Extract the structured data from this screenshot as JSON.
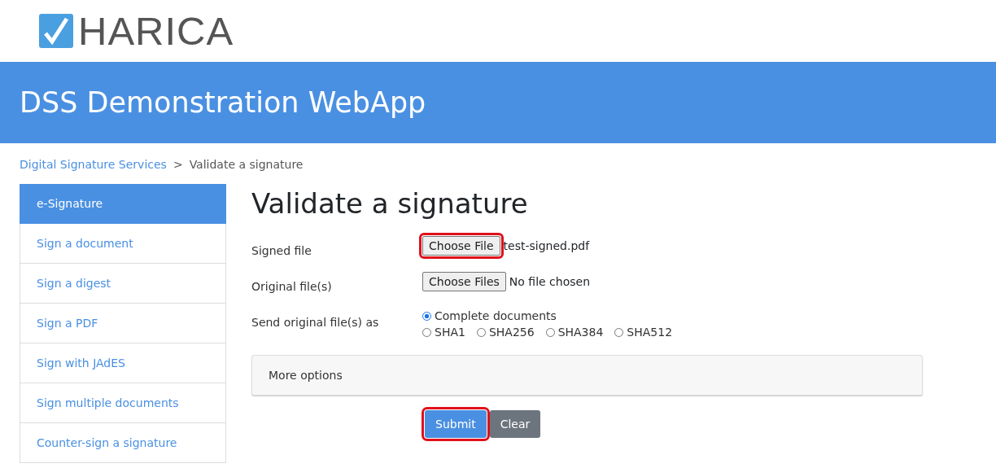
{
  "logo": {
    "text": "HARICA"
  },
  "header": {
    "title": "DSS Demonstration WebApp"
  },
  "breadcrumb": [
    {
      "label": "Digital Signature Services",
      "kind": "link"
    },
    {
      "label": ">",
      "kind": "separator"
    },
    {
      "label": "Validate a signature",
      "kind": "current"
    }
  ],
  "sidebar": {
    "items": [
      {
        "label": "e-Signature",
        "selected": true
      },
      {
        "label": "Sign a document",
        "selected": false
      },
      {
        "label": "Sign a digest",
        "selected": false
      },
      {
        "label": "Sign a PDF",
        "selected": false
      },
      {
        "label": "Sign with JAdES",
        "selected": false
      },
      {
        "label": "Sign multiple documents",
        "selected": false
      },
      {
        "label": "Counter-sign a signature",
        "selected": false
      }
    ]
  },
  "page_title": "Validate a signature",
  "form": {
    "rows": [
      {
        "label": "Signed file",
        "kind": "file",
        "button": "Choose File",
        "value": "test-signed.pdf",
        "highlighted": true
      },
      {
        "label": "Original file(s)",
        "kind": "file",
        "button": "Choose Files",
        "value": "No file chosen",
        "highlighted": false
      },
      {
        "label": "Send original file(s) as",
        "kind": "radios",
        "options": [
          {
            "label": "Complete documents",
            "selected": true
          },
          {
            "label": "SHA1",
            "selected": false
          },
          {
            "label": "SHA256",
            "selected": false
          },
          {
            "label": "SHA384",
            "selected": false
          },
          {
            "label": "SHA512",
            "selected": false
          }
        ]
      }
    ]
  },
  "more_options": {
    "label": "More options"
  },
  "buttons": [
    {
      "label": "Submit",
      "kind": "primary",
      "highlighted": true
    },
    {
      "label": "Clear",
      "kind": "secondary",
      "highlighted": false
    }
  ]
}
